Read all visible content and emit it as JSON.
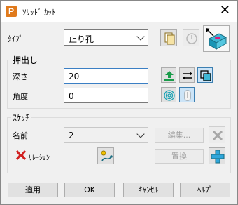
{
  "window": {
    "title": "ｿﾘｯﾄﾞ ｶｯﾄ"
  },
  "type_row": {
    "label": "ﾀｲﾌﾟ",
    "value": "止り孔"
  },
  "extrude": {
    "title": "押出し",
    "depth_label": "深さ",
    "depth_value": "20",
    "angle_label": "角度",
    "angle_value": "0"
  },
  "sketch": {
    "title": "ｽｹｯﾁ",
    "name_label": "名前",
    "name_value": "2",
    "edit_label": "編集...",
    "replace_label": "置換",
    "relation_label": "ﾘﾚｰｼｮﾝ"
  },
  "buttons": {
    "apply": "適用",
    "ok": "OK",
    "cancel": "ｷｬﾝｾﾙ",
    "help": "ﾍﾙﾌﾟ"
  },
  "colors": {
    "accent_blue": "#3b7fc4",
    "teal": "#1aa3b5",
    "green": "#1a9c4a",
    "red": "#d12020"
  }
}
